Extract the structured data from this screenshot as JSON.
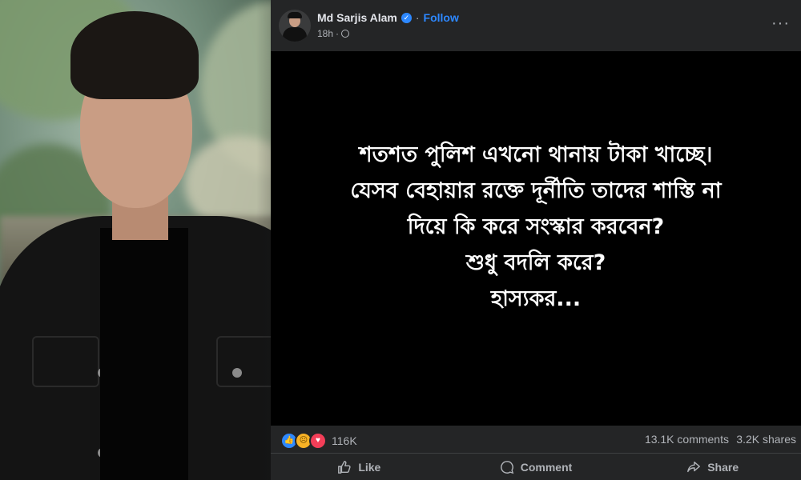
{
  "post": {
    "author": "Md Sarjis Alam",
    "follow_label": "Follow",
    "time": "18h",
    "text_lines": [
      "শতশত পুলিশ এখনো থানায় টাকা খাচ্ছে।",
      "যেসব বেহায়ার রক্তে দূর্নীতি তাদের শাস্তি না",
      "দিয়ে কি করে সংস্কার করবেন?",
      "শুধু বদলি করে?",
      "হাস্যকর..."
    ]
  },
  "stats": {
    "reactions_count": "116K",
    "comments": "13.1K comments",
    "shares": "3.2K shares"
  },
  "actions": {
    "like": "Like",
    "comment": "Comment",
    "share": "Share"
  },
  "colors": {
    "accent": "#2d88ff",
    "card_bg": "#242526",
    "post_bg": "#000000",
    "muted_text": "#b0b3b8"
  }
}
